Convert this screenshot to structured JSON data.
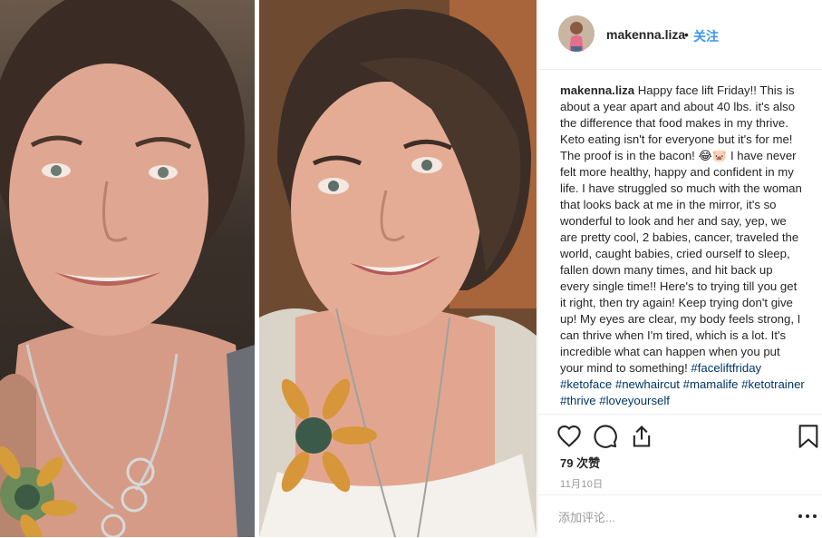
{
  "post": {
    "image_alt": "Before and after face comparison photo"
  },
  "header": {
    "username": "makenna.liza",
    "separator": "•",
    "follow_label": "关注"
  },
  "caption": {
    "username": "makenna.liza",
    "text": "Happy face lift Friday!! This is about a year apart and about 40 lbs. it's also the difference that food makes in my thrive. Keto eating isn't for everyone but it's for me! The proof is in the bacon! 😂🐷 I have never felt more healthy, happy and confident in my life. I have struggled so much with the woman that looks back at me in the mirror, it's so wonderful to look and her and say, yep, we are pretty cool, 2 babies, cancer, traveled the world, caught babies, cried ourself to sleep, fallen down many times, and hit back up every single time!! Here's to trying till you get it right, then try again! Keep trying don't give up! My eyes are clear, my body feels strong, I can thrive when I'm tired, which is a lot. It's incredible what can happen when you put your mind to something!",
    "hashtags": [
      "#faceliftfriday",
      "#ketoface",
      "#newhaircut",
      "#mamalife",
      "#ketotrainer",
      "#thrive",
      "#loveyourself"
    ]
  },
  "actions": {
    "like_icon": "heart-icon",
    "comment_icon": "comment-icon",
    "share_icon": "share-icon",
    "save_icon": "bookmark-icon"
  },
  "likes": {
    "text": "79 次赞"
  },
  "date": {
    "text": "11月10日"
  },
  "comment_box": {
    "placeholder": "添加评论...",
    "more_icon": "more-options-icon"
  },
  "colors": {
    "link": "#3897f0",
    "hashtag": "#003569",
    "border": "#efefef",
    "muted": "#999999"
  }
}
